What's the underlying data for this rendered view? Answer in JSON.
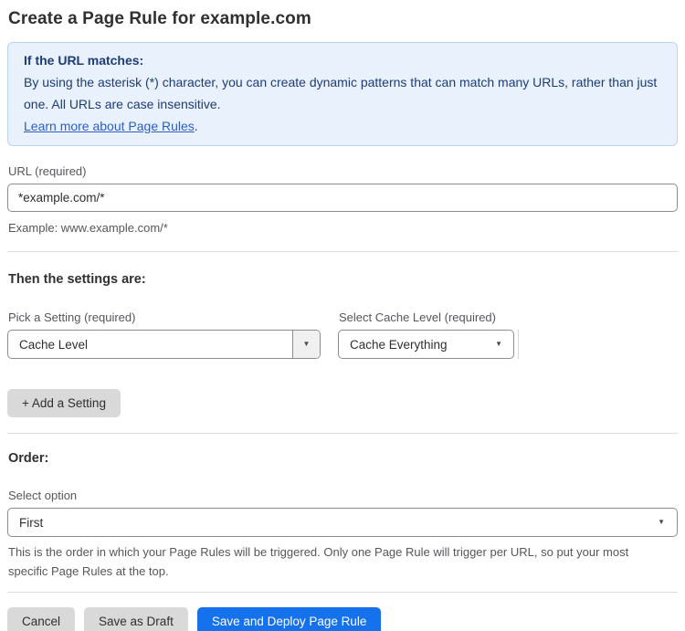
{
  "page": {
    "title": "Create a Page Rule for example.com"
  },
  "info_box": {
    "heading": "If the URL matches:",
    "body": "By using the asterisk (*) character, you can create dynamic patterns that can match many URLs, rather than just one. All URLs are case insensitive.",
    "link_label": "Learn more about Page Rules",
    "link_suffix": "."
  },
  "url_field": {
    "label": "URL (required)",
    "value": "*example.com/*",
    "helper": "Example: www.example.com/*"
  },
  "settings_section": {
    "heading": "Then the settings are:",
    "setting_select": {
      "label": "Pick a Setting (required)",
      "value": "Cache Level"
    },
    "cache_level_select": {
      "label": "Select Cache Level (required)",
      "value": "Cache Everything"
    },
    "add_setting_label": "+ Add a Setting"
  },
  "order_section": {
    "heading": "Order:",
    "select_label": "Select option",
    "value": "First",
    "helper": "This is the order in which your Page Rules will be triggered. Only one Page Rule will trigger per URL, so put your most specific Page Rules at the top."
  },
  "actions": {
    "cancel": "Cancel",
    "save_draft": "Save as Draft",
    "save_deploy": "Save and Deploy Page Rule"
  },
  "colors": {
    "accent_blue": "#1672ec",
    "info_bg": "#e8f1fc",
    "info_border": "#b9d4f1",
    "info_text": "#1e3c78",
    "link": "#2c5fc4"
  }
}
